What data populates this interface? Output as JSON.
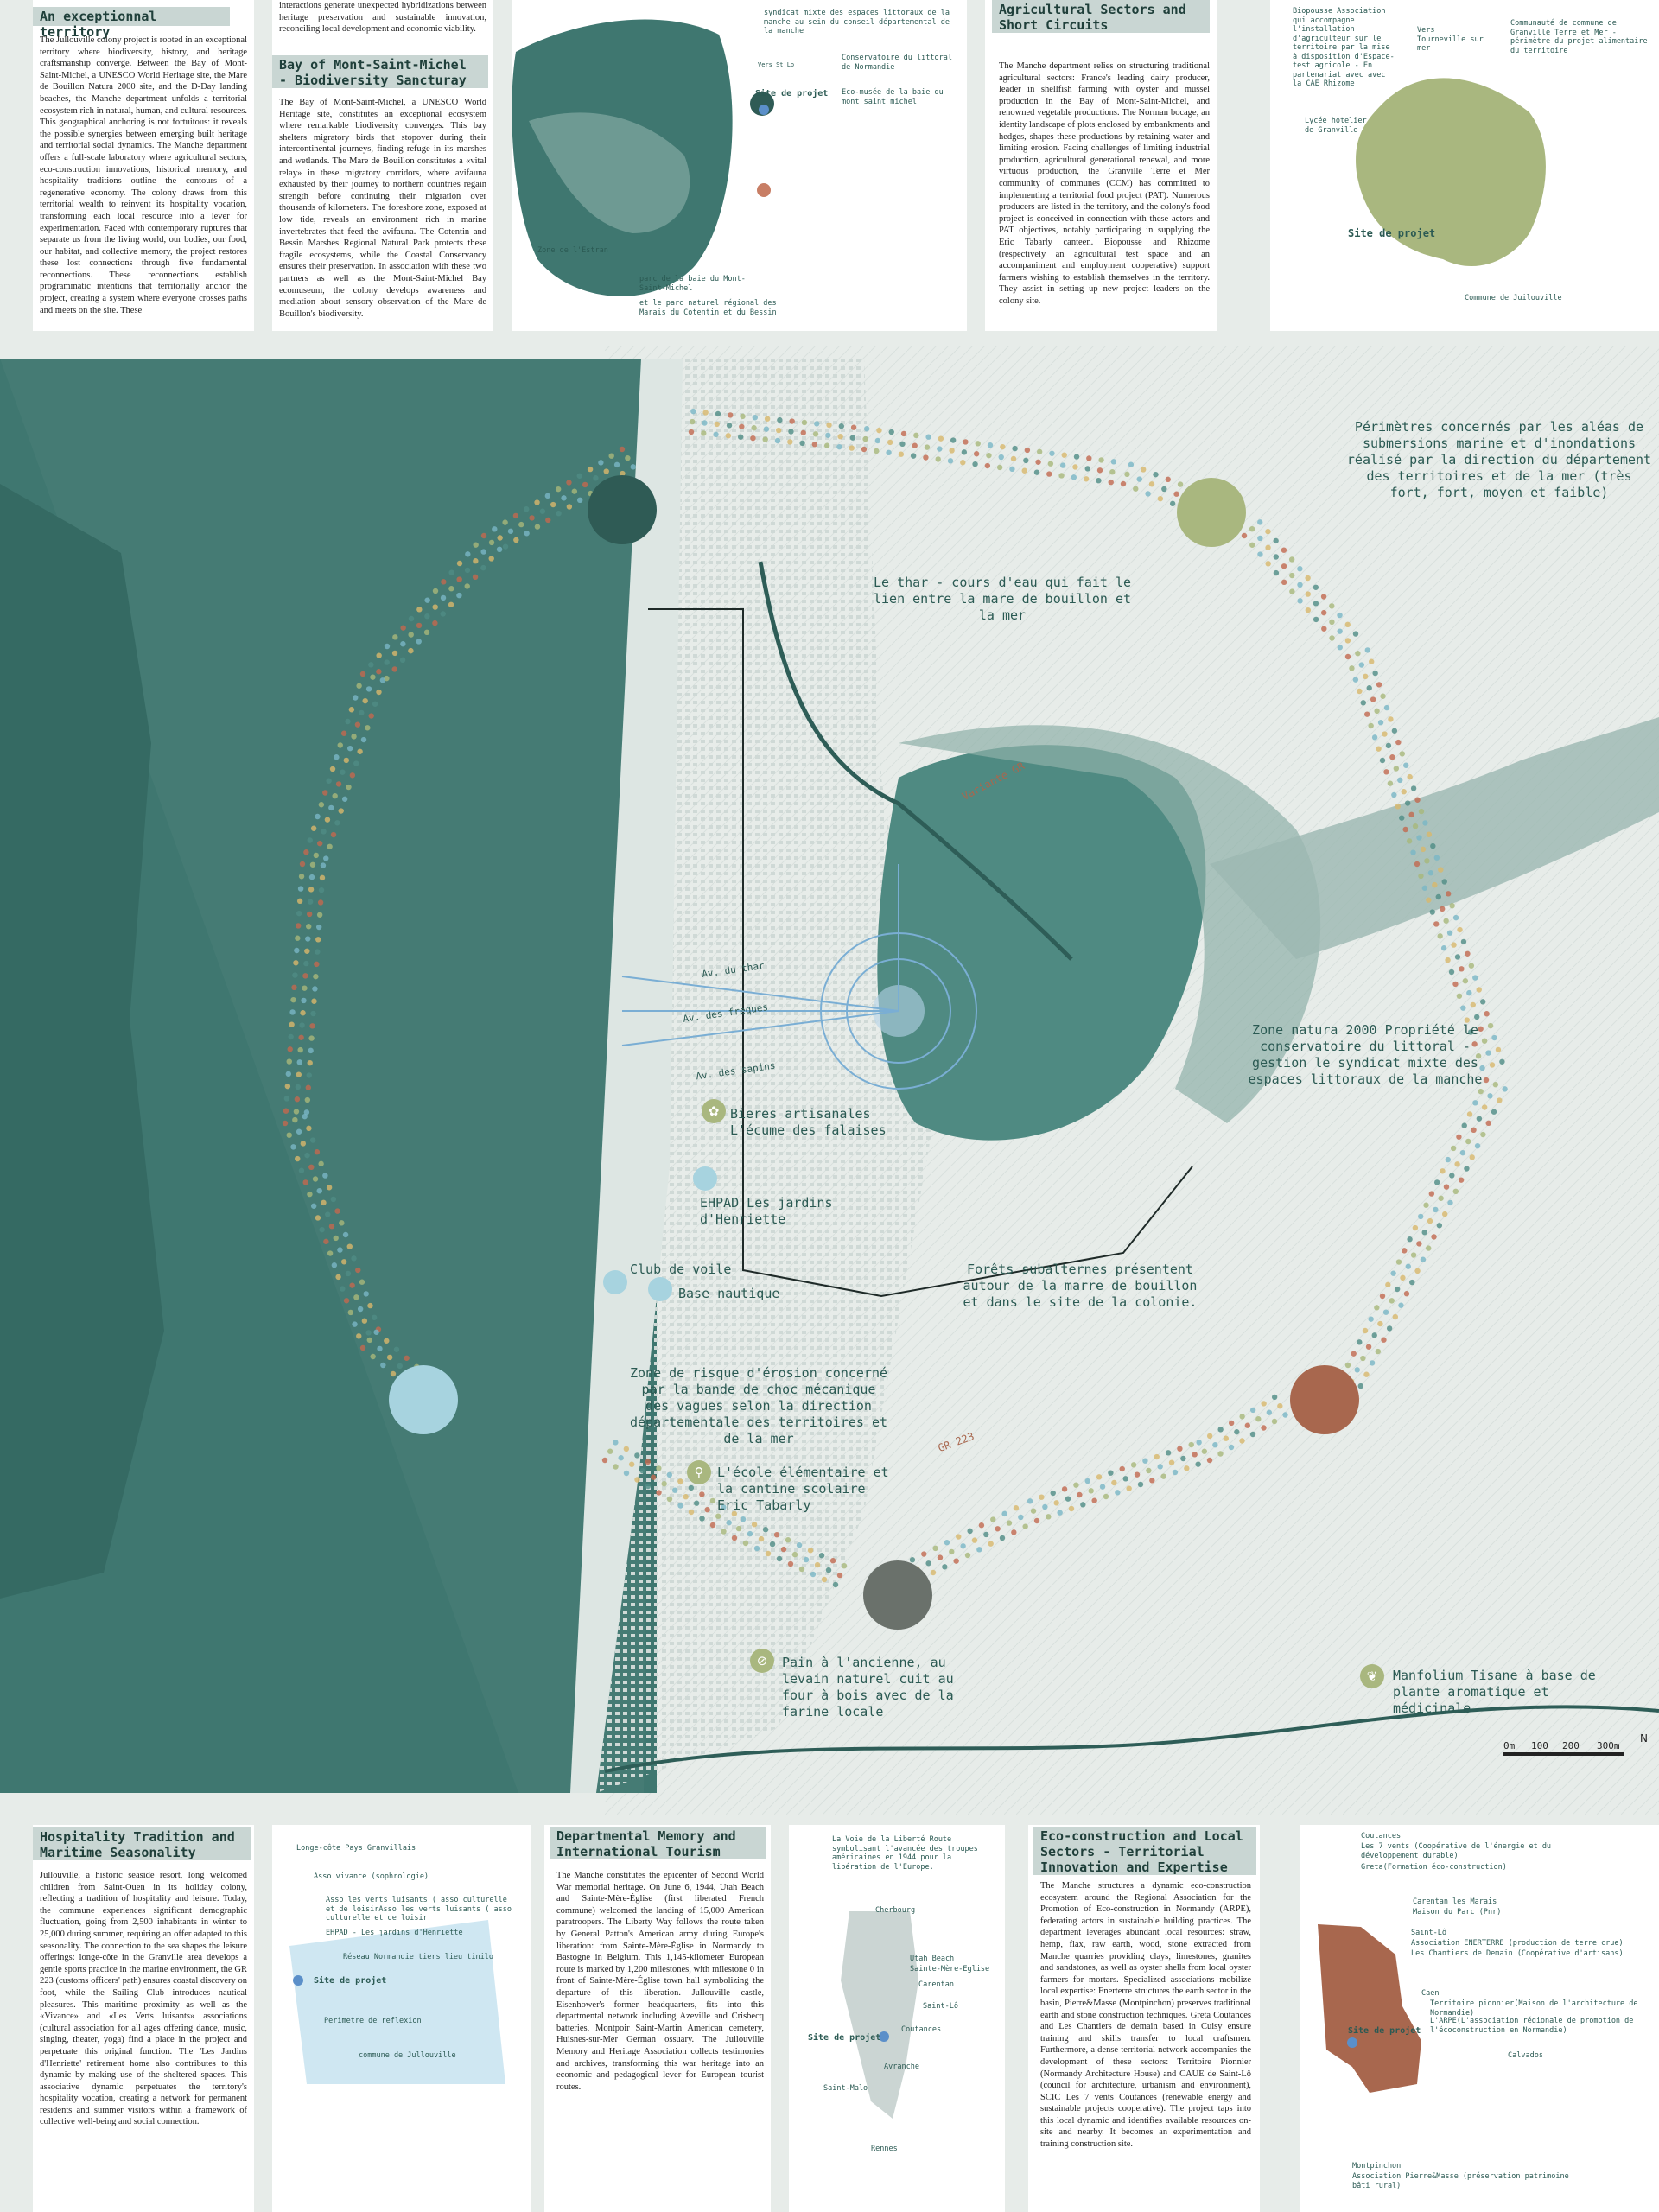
{
  "panels": {
    "exceptional": {
      "title": "An exceptionnal territory",
      "body": "The Jullouville colony project is rooted in an exceptional territory where biodiversity, history, and heritage craftsmanship converge. Between the Bay of Mont-Saint-Michel, a UNESCO World Heritage site, the Mare de Bouillon Natura 2000 site, and the D-Day landing beaches, the Manche department unfolds a territorial ecosystem rich in natural, human, and cultural resources. This geographical anchoring is not fortuitous: it reveals the possible synergies between emerging built heritage and territorial social dynamics. The Manche department offers a full-scale laboratory where agricultural sectors, eco-construction innovations, historical memory, and hospitality traditions outline the contours of a regenerative economy. The colony draws from this territorial wealth to reinvent its hospitality vocation, transforming each local resource into a lever for experimentation. Faced with contemporary ruptures that separate us from the living world, our bodies, our food, our habitat, and collective memory, the project restores these lost connections through five fundamental reconnections. These reconnections establish programmatic intentions that territorially anchor the project, creating a system where everyone crosses paths and meets on the site. These"
    },
    "bay": {
      "intro": "interactions generate unexpected hybridizations between heritage preservation and sustainable innovation, reconciling local development and economic viability.",
      "title": "Bay of Mont-Saint-Michel - Biodiversity Sancturay",
      "body": "The Bay of Mont-Saint-Michel, a UNESCO World Heritage site, constitutes an exceptional ecosystem where remarkable biodiversity converges. This bay shelters migratory birds that stopover during their intercontinental journeys, finding refuge in its marshes and wetlands. The Mare de Bouillon constitutes a «vital relay» in these migratory corridors, where avifauna exhausted by their journey to northern countries regain strength before continuing their migration over thousands of kilometers. The foreshore zone, exposed at low tide, reveals an environment rich in marine invertebrates that feed the avifauna. The Cotentin and Bessin Marshes Regional Natural Park protects these fragile ecosystems, while the Coastal Conservancy ensures their preservation. In association with these two partners as well as the Mont-Saint-Michel Bay ecomuseum, the colony develops awareness and mediation about sensory observation of the Mare de Bouillon's biodiversity."
    },
    "bay_map": {
      "labels": [
        "syndicat mixte des espaces littoraux de la manche au sein du conseil départemental de la manche",
        "Conservatoire du littoral de Normandie",
        "Eco-musée de la baie du mont saint michel",
        "Site de projet",
        "Vers St Lo",
        "Zone de l'Estran",
        "parc de la baie du Mont-Saint-Michel",
        "et le parc naturel régional des Marais du Cotentin et du Bessin"
      ]
    },
    "agri": {
      "title": "Agricultural Sectors and Short Circuits",
      "body": "The Manche department relies on structuring traditional agricultural sectors: France's leading dairy producer, leader in shellfish farming with oyster and mussel production in the Bay of Mont-Saint-Michel, and renowned vegetable productions. The Norman bocage, an identity landscape of plots enclosed by embankments and hedges, shapes these productions by retaining water and limiting erosion. Facing challenges of limiting industrial production, agricultural generational renewal, and more virtuous production, the Granville Terre et Mer community of communes (CCM) has committed to implementing a territorial food project (PAT). Numerous producers are listed in the territory, and the colony's food project is conceived in connection with these actors and PAT objectives, notably participating in supplying the Eric Tabarly canteen. Biopousse and Rhizome (respectively an agricultural test space and an accompaniment and employment cooperative) support farmers wishing to establish themselves in the territory. They assist in setting up new project leaders on the colony site."
    },
    "agri_map": {
      "labels": [
        "Biopousse Association qui accompagne l'installation d'agriculteur sur le territoire par la mise à disposition d'Espace-test agricole - En partenariat avec avec la CAE Rhizome",
        "Vers Tourneville sur mer",
        "Communauté de commune de Granville Terre et Mer - périmètre du projet alimentaire du territoire",
        "Lycée hotelier de Granville",
        "Site de projet",
        "Commune de Juilouville"
      ]
    },
    "hosp": {
      "title": "Hospitality Tradition and Maritime Seasonality",
      "body": "Jullouville, a historic seaside resort, long welcomed children from Saint-Ouen in its holiday colony, reflecting a tradition of hospitality and leisure. Today, the commune experiences significant demographic fluctuation, going from 2,500 inhabitants in winter to 25,000 during summer, requiring an offer adapted to this seasonality. The connection to the sea shapes the leisure offerings: longe-côte in the Granville area develops a gentle sports practice in the marine environment, the GR 223 (customs officers' path) ensures coastal discovery on foot, while the Sailing Club introduces nautical pleasures. This maritime proximity as well as the «Vivance» and «Les Verts luisants» associations (cultural association for all ages offering dance, music, singing, theater, yoga) find a place in the project and perpetuate this original function. The 'Les Jardins d'Henriette' retirement home also contributes to this dynamic by making use of the sheltered spaces. This associative dynamic perpetuates the territory's hospitality vocation, creating a network for permanent residents and summer visitors within a framework of collective well-being and social connection."
    },
    "hosp_map": {
      "labels": [
        "Longe-côte Pays Granvillais",
        "Asso vivance (sophrologie)",
        "Asso les verts luisants ( asso culturelle et de loisirAsso les verts luisants ( asso culturelle et de loisir",
        "EHPAD - Les jardins d'Henriette",
        "Réseau Normandie tiers lieu tinilo",
        "Site de projet",
        "Perimetre de reflexion",
        "commune de Jullouville"
      ]
    },
    "memory": {
      "title": "Departmental Memory and International Tourism",
      "body": "The Manche constitutes the epicenter of Second World War memorial heritage. On June 6, 1944, Utah Beach and Sainte-Mère-Église (first liberated French commune) welcomed the landing of 15,000 American paratroopers. The Liberty Way follows the route taken by General Patton's American army during Europe's liberation: from Sainte-Mère-Église in Normandy to Bastogne in Belgium. This 1,145-kilometer European route is marked by 1,200 milestones, with milestone 0 in front of Sainte-Mère-Église town hall symbolizing the departure of this liberation. Jullouville castle, Eisenhower's former headquarters, fits into this departmental network including Azeville and Crisbecq batteries, Montpoir Saint-Martin American cemetery, Huisnes-sur-Mer German ossuary. The Jullouville Memory and Heritage Association collects testimonies and archives, transforming this war heritage into an economic and pedagogical lever for European tourist routes."
    },
    "memory_map": {
      "labels": [
        "La Voie de la Liberté Route symbolisant l'avancée des troupes américaines en 1944 pour la libération de l'Europe.",
        "Cherbourg",
        "Utah Beach",
        "Sainte-Mère-Eglise",
        "Carentan",
        "Saint-Lô",
        "Coutances",
        "Site de projet",
        "Avranche",
        "Saint-Malo",
        "Rennes"
      ]
    },
    "eco": {
      "title": "Eco-construction and Local Sectors - Territorial Innovation and Expertise",
      "body": "The Manche structures a dynamic eco-construction ecosystem around the Regional Association for the Promotion of Eco-construction in Normandy (ARPE), federating actors in sustainable building practices. The department leverages abundant local resources: straw, hemp, flax, raw earth, wood, stone extracted from Manche quarries providing clays, limestones, granites and sandstones, as well as oyster shells from local oyster farmers for mortars. Specialized associations mobilize local expertise: Enerterre structures the earth sector in the basin, Pierre&Masse (Montpinchon) preserves traditional earth and stone construction techniques. Greta Coutances and Les Chantiers de demain based in Cuisy ensure training and skills transfer to local craftsmen. Furthermore, a dense territorial network accompanies the development of these sectors: Territoire Pionnier (Normandy Architecture House) and CAUE de Saint-Lô (council for architecture, urbanism and environment), SCIC Les 7 vents Coutances (renewable energy and sustainable projects cooperative). The project taps into this local dynamic and identifies available resources on-site and nearby. It becomes an experimentation and training construction site."
    },
    "eco_map": {
      "labels": [
        "Coutances",
        "Les 7 vents (Coopérative de l'énergie et du développement durable)",
        "Greta(Formation éco-construction)",
        "Carentan les Marais",
        "Maison du Parc (Pnr)",
        "Saint-Lô",
        "Association ENERTERRE (production de terre crue)",
        "Les Chantiers de Demain (Coopérative d'artisans)",
        "Caen",
        "Territoire pionnier(Maison de l'architecture de Normandie)",
        "L'ARPE(L'association régionale de promotion de l'écoconstruction en Normandie)",
        "Calvados",
        "Site de projet",
        "Montpinchon",
        "Association Pierre&Masse (préservation patrimoine bâti rural)"
      ]
    }
  },
  "map_labels": {
    "submersion": "Périmètres concernés par les aléas de submersions marine et d'inondations réalisé par la direction du département des territoires et de la mer (très fort, fort, moyen et faible)",
    "thar": "Le thar - cours d'eau qui fait le lien entre la mare de bouillon et la mer",
    "variante": "Variante GR",
    "natura": "Zone natura 2000 Propriété le conservatoire du littoral - gestion le syndicat mixte des espaces littoraux de la manche",
    "bieres": "Bieres artisanales L'écume des falaises",
    "ehpad": "EHPAD Les jardins d'Henriette",
    "club": "Club de voile",
    "base": "Base nautique",
    "forets": "Forêts subalternes présentent autour de la marre de bouillon et dans le site de la colonie.",
    "erosion": "Zone de risque d'érosion concerné par la bande de choc mécanique des vagues selon la direction départementale des territoires et de la mer",
    "gr223": "GR 223",
    "ecole": "L'école élémentaire et la cantine scolaire Eric Tabarly",
    "pain": "Pain à l'ancienne, au levain naturel cuit au four à bois avec de la farine locale",
    "manfolium": "Manfolium Tisane à base de plante aromatique et médicinale",
    "av_thar": "Av. du thar",
    "av_freques": "Av. des freques",
    "av_sapins": "Av. des sapins"
  },
  "scale": {
    "labels": [
      "0m",
      "100",
      "200",
      "300m"
    ],
    "north": "N"
  },
  "colors": {
    "sea": "#3f7770",
    "sea_light": "#5d948b",
    "urban": "#f6f8f7",
    "olive": "#a9b77f",
    "brick": "#a8674e",
    "sky": "#a7d3df",
    "grey": "#6a716b",
    "dot_colors": [
      "#c2694f",
      "#a7b87a",
      "#79b7c6",
      "#d8b86c",
      "#4f8c84"
    ]
  }
}
